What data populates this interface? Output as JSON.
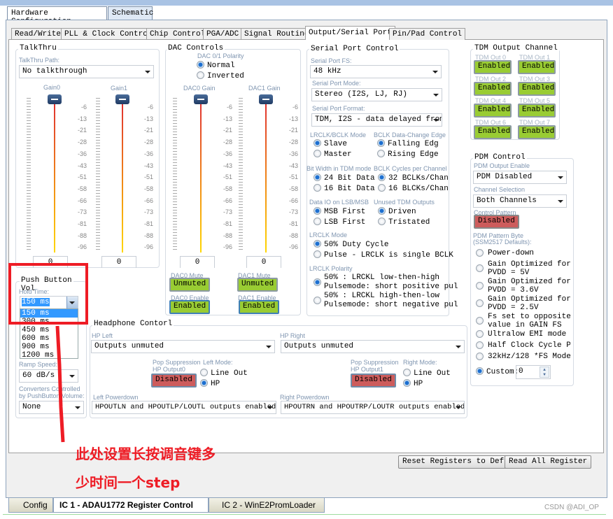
{
  "outer_tabs": [
    {
      "label": "Hardware Configuration"
    },
    {
      "label": "Schematic"
    }
  ],
  "inner_tabs": [
    {
      "label": "Read/Write"
    },
    {
      "label": "PLL & Clock Control"
    },
    {
      "label": "Chip Control"
    },
    {
      "label": "PGA/ADC"
    },
    {
      "label": "Signal Routing"
    },
    {
      "label": "Output/Serial Port"
    },
    {
      "label": "Pin/Pad Control"
    }
  ],
  "slider_ticks": [
    "-6",
    "-13",
    "-21",
    "-28",
    "-36",
    "-43",
    "-51",
    "-58",
    "-66",
    "-73",
    "-81",
    "-88",
    "-96"
  ],
  "talkthru": {
    "title": "TalkThru",
    "path_label": "TalkThru Path:",
    "path_value": "No talkthrough",
    "gain0_label": "Gain0",
    "gain1_label": "Gain1",
    "gain0_value": "0",
    "gain1_value": "0"
  },
  "dac": {
    "title": "DAC Controls",
    "polarity_label": "DAC 0/1 Polarity",
    "normal": "Normal",
    "inverted": "Inverted",
    "dac0_gain_label": "DAC0 Gain",
    "dac1_gain_label": "DAC1 Gain",
    "dac0_value": "0",
    "dac1_value": "0",
    "dac0_mute_label": "DAC0 Mute",
    "dac1_mute_label": "DAC1 Mute",
    "dac0_mute": "Unmuted",
    "dac1_mute": "Unmuted",
    "dac0_enable_label": "DAC0 Enable",
    "dac1_enable_label": "DAC1 Enable",
    "dac0_enable": "Enabled",
    "dac1_enable": "Enabled"
  },
  "serial": {
    "title": "Serial Port Control",
    "fs_label": "Serial Port FS:",
    "fs_value": "48 kHz",
    "mode_label": "Serial Port Mode:",
    "mode_value": "Stereo (I2S, LJ, RJ)",
    "format_label": "Serial Port Format:",
    "format_value": "TDM, I2S - data delayed from",
    "lrclk_bclk_label": "LRCLK/BCLK Mode",
    "slave": "Slave",
    "master": "Master",
    "bclk_edge_label": "BCLK Data-Change Edge",
    "falling": "Falling Edg",
    "rising": "Rising Edge",
    "bitwidth_label": "Bit Width in TDM mode",
    "bit24": "24 Bit Data",
    "bit16": "16 Bit Data",
    "bclk_cycles_label": "BCLK Cycles per Channel",
    "bclk32": "32 BCLKs/Chan",
    "bclk16": "16 BLCKs/Chan",
    "dataio_label": "Data IO on LSB/MSB",
    "msb": "MSB First",
    "lsb": "LSB First",
    "unused_label": "Unused TDM Outputs",
    "driven": "Driven",
    "tristated": "Tristated",
    "lrclk_mode_label": "LRCLK Mode",
    "duty50": "50% Duty Cycle",
    "pulse": "Pulse - LRCLK is single BCLK",
    "polarity_label": "LRCLK Polarity",
    "pol1a": "50% : LRCKL low-then-high",
    "pol1b": "Pulsemode: short positive pul",
    "pol2a": "50% : LRCKL high-then-low",
    "pol2b": "Pulsemode: short negative pul"
  },
  "tdm": {
    "title": "TDM Output Channel",
    "channels": [
      {
        "label": "TDM Out 0",
        "value": "Enabled"
      },
      {
        "label": "TDM Out 1",
        "value": "Enabled"
      },
      {
        "label": "TDM Out 2",
        "value": "Enabled"
      },
      {
        "label": "TDM Out 3",
        "value": "Enabled"
      },
      {
        "label": "TDM Out 4",
        "value": "Enabled"
      },
      {
        "label": "TDM Out 5",
        "value": "Enabled"
      },
      {
        "label": "TDM Out 6",
        "value": "Enabled"
      },
      {
        "label": "TDM Out 7",
        "value": "Enabled"
      }
    ]
  },
  "pdm": {
    "title": "PDM Control",
    "enable_label": "PDM Output Enable",
    "enable_value": "PDM Disabled",
    "channel_label": "Channel Selection",
    "channel_value": "Both Channels",
    "pattern_label": "Control Pattern",
    "pattern_value": "Disabled",
    "byte_label1": "PDM Pattern Byte",
    "byte_label2": "(SSM2517 Defaults):",
    "options": [
      "Power-down",
      "Gain Optimized for|PVDD = 5V",
      "Gain Optimized for|PVDD = 3.6V",
      "Gain Optimized for|PVDD = 2.5V",
      "Fs set to opposite|value in GAIN FS",
      "Ultralow EMI mode",
      "Half Clock Cycle Pul",
      "32kHz/128 *FS Mode"
    ],
    "custom_label": "Custom:",
    "custom_value": "0"
  },
  "push": {
    "title1": "Push Button",
    "title2": "Vol",
    "hold_label": "Hold Time:",
    "hold_value": "150 ms",
    "hold_options": [
      "150 ms",
      "300 ms",
      "450 ms",
      "600 ms",
      "900 ms",
      "1200 ms"
    ],
    "ramp_label": "Ramp Speed:",
    "ramp_value": "60 dB/s",
    "conv_label1": "Converters Controlled",
    "conv_label2": "by PushButton Volume:",
    "conv_value": "None"
  },
  "hp": {
    "title": "Headphone Contorl",
    "left_label": "HP Left",
    "left_value": "Outputs unmuted",
    "right_label": "HP Right",
    "right_value": "Outputs unmuted",
    "pop_left1": "Pop Suppression",
    "pop_left2": "HP Output0",
    "left_mode": "Left Mode:",
    "pop_right1": "Pop Suppression",
    "pop_right2": "HP Output1",
    "right_mode": "Right Mode:",
    "pop_value": "Disabled",
    "line_out": "Line Out",
    "hp": "HP",
    "left_pd_label": "Left Powerdown",
    "left_pd_value": "HPOUTLN and HPOUTLP/LOUTL outputs enabled",
    "right_pd_label": "Right Powerdown",
    "right_pd_value": "HPOUTRN and HPOUTRP/LOUTR outputs enabled"
  },
  "buttons": {
    "reset": "Reset Registers to Def",
    "read_all": "Read All Register"
  },
  "bottom_tabs": [
    {
      "label": "Config"
    },
    {
      "label": "IC 1 - ADAU1772 Register Control"
    },
    {
      "label": "IC 2 - WinE2PromLoader"
    }
  ],
  "annotation": {
    "line1": "此处设置长按调音键多",
    "line2": "少时间一个step",
    "color": "#ee1c25"
  },
  "watermark": "CSDN @ADI_OP"
}
